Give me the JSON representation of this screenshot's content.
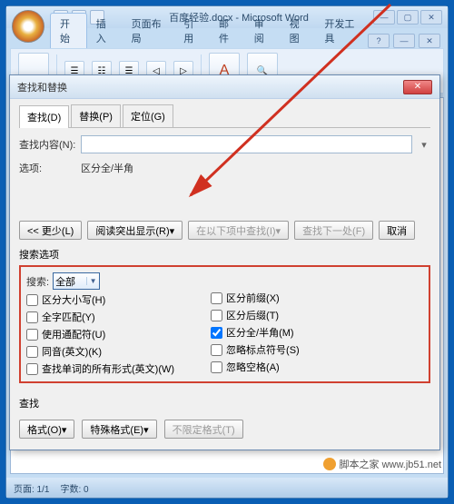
{
  "title": "百度经验.docx - Microsoft Word",
  "ribbon": {
    "tabs": [
      "开始",
      "插入",
      "页面布局",
      "引用",
      "邮件",
      "审阅",
      "视图",
      "开发工具"
    ],
    "active_index": 0
  },
  "status": {
    "page": "页面: 1/1",
    "words": "字数: 0"
  },
  "dialog": {
    "title": "查找和替换",
    "tabs": [
      {
        "label": "查找(D)",
        "active": true
      },
      {
        "label": "替换(P)",
        "active": false
      },
      {
        "label": "定位(G)",
        "active": false
      }
    ],
    "find_label": "查找内容(N):",
    "find_value": "",
    "options_label": "选项:",
    "options_value": "区分全/半角",
    "buttons": {
      "less": "<< 更少(L)",
      "reading": "阅读突出显示(R)▾",
      "find_in": "在以下项中查找(I)▾",
      "find_next": "查找下一处(F)",
      "cancel": "取消"
    },
    "search_section": "搜索选项",
    "search_label": "搜索:",
    "search_direction": "全部",
    "checkboxes_left": [
      {
        "label": "区分大小写(H)",
        "checked": false
      },
      {
        "label": "全字匹配(Y)",
        "checked": false
      },
      {
        "label": "使用通配符(U)",
        "checked": false
      },
      {
        "label": "同音(英文)(K)",
        "checked": false
      },
      {
        "label": "查找单词的所有形式(英文)(W)",
        "checked": false
      }
    ],
    "checkboxes_right": [
      {
        "label": "区分前缀(X)",
        "checked": false
      },
      {
        "label": "区分后缀(T)",
        "checked": false
      },
      {
        "label": "区分全/半角(M)",
        "checked": true
      },
      {
        "label": "忽略标点符号(S)",
        "checked": false
      },
      {
        "label": "忽略空格(A)",
        "checked": false
      }
    ],
    "find_section": "查找",
    "bottom_buttons": {
      "format": "格式(O)▾",
      "special": "特殊格式(E)▾",
      "no_format": "不限定格式(T)"
    }
  },
  "watermark": "脚本之家 www.jb51.net"
}
